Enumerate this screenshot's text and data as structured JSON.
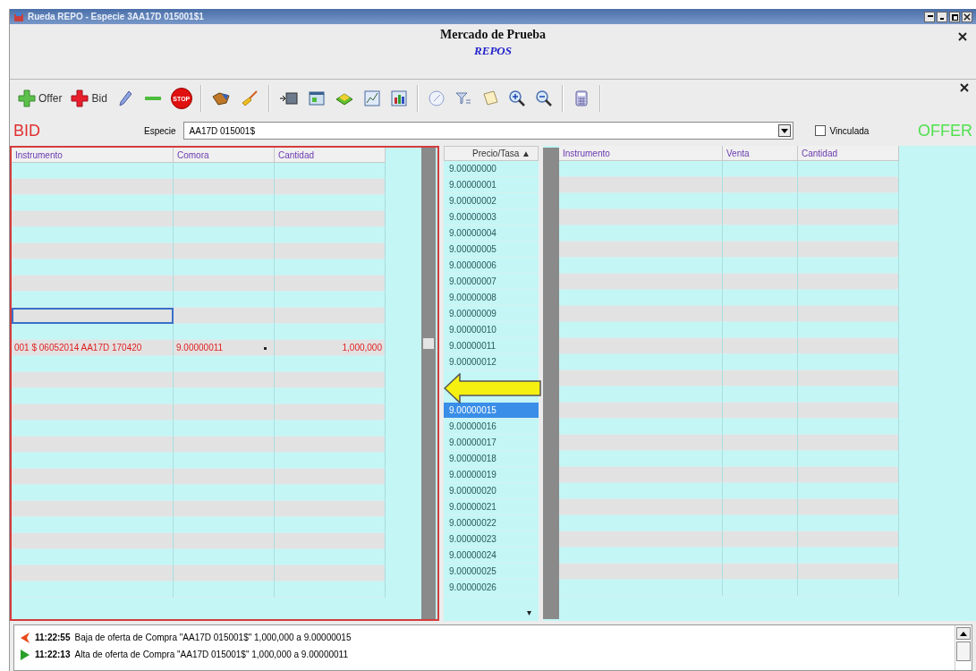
{
  "window": {
    "title": "Rueda REPO - Especie 3AA17D 015001$1"
  },
  "header": {
    "title": "Mercado de Prueba",
    "subtitle": "REPOS"
  },
  "toolbar": [
    {
      "kind": "text",
      "label": "Offer"
    },
    {
      "kind": "text",
      "label": "Bid"
    },
    {
      "kind": "icon"
    },
    {
      "kind": "icon"
    },
    {
      "kind": "stop",
      "label": "STOP"
    },
    {
      "kind": "sep"
    },
    {
      "kind": "icon"
    },
    {
      "kind": "icon"
    },
    {
      "kind": "sep"
    },
    {
      "kind": "icon"
    },
    {
      "kind": "icon"
    },
    {
      "kind": "icon"
    },
    {
      "kind": "icon"
    },
    {
      "kind": "icon"
    },
    {
      "kind": "sep"
    },
    {
      "kind": "icon"
    },
    {
      "kind": "icon"
    },
    {
      "kind": "icon"
    },
    {
      "kind": "icon"
    },
    {
      "kind": "icon"
    },
    {
      "kind": "sep"
    },
    {
      "kind": "icon"
    },
    {
      "kind": "sep"
    }
  ],
  "bid_label": "BID",
  "offer_label": "OFFER",
  "especie": {
    "label": "Especie",
    "value": "AA17D 015001$"
  },
  "vinculada": {
    "label": "Vinculada",
    "checked": false
  },
  "bid_grid": {
    "columns": [
      "Instrumento",
      "Comora",
      "Cantidad"
    ],
    "rows": [
      {
        "focused": false
      },
      {
        "focused": false
      },
      {
        "focused": false
      },
      {
        "focused": false
      },
      {
        "focused": false
      },
      {
        "focused": false
      },
      {
        "focused": false
      },
      {
        "focused": false
      },
      {
        "focused": false
      },
      {
        "focused": true
      },
      {
        "focused": false
      },
      {
        "focused": false,
        "cells": [
          "001 $ 06052014 AA17D 170420",
          "9.00000011",
          "1,000,000"
        ]
      },
      {
        "focused": false
      },
      {
        "focused": false
      },
      {
        "focused": false
      },
      {
        "focused": false
      },
      {
        "focused": false
      },
      {
        "focused": false
      },
      {
        "focused": false
      },
      {
        "focused": false
      },
      {
        "focused": false
      },
      {
        "focused": false
      },
      {
        "focused": false
      },
      {
        "focused": false
      },
      {
        "focused": false
      },
      {
        "focused": false
      },
      {
        "focused": false
      }
    ]
  },
  "price_ladder": {
    "header": "Precio/Tasa ▲",
    "sort_arrow": "▾",
    "rows": [
      {
        "kind": "price",
        "price": "9.00000000",
        "selected": false
      },
      {
        "kind": "price",
        "price": "9.00000001",
        "selected": false
      },
      {
        "kind": "price",
        "price": "9.00000002",
        "selected": false
      },
      {
        "kind": "price",
        "price": "9.00000003",
        "selected": false
      },
      {
        "kind": "price",
        "price": "9.00000004",
        "selected": false
      },
      {
        "kind": "price",
        "price": "9.00000005",
        "selected": false
      },
      {
        "kind": "price",
        "price": "9.00000006",
        "selected": false
      },
      {
        "kind": "price",
        "price": "9.00000007",
        "selected": false
      },
      {
        "kind": "price",
        "price": "9.00000008",
        "selected": false
      },
      {
        "kind": "price",
        "price": "9.00000009",
        "selected": false
      },
      {
        "kind": "price",
        "price": "9.00000010",
        "selected": false
      },
      {
        "kind": "price",
        "price": "9.00000011",
        "selected": false
      },
      {
        "kind": "price",
        "price": "9.00000012",
        "selected": false
      },
      {
        "kind": "arrow"
      },
      {
        "kind": "price",
        "price": "9.00000015",
        "selected": true
      },
      {
        "kind": "price",
        "price": "9.00000016",
        "selected": false
      },
      {
        "kind": "price",
        "price": "9.00000017",
        "selected": false
      },
      {
        "kind": "price",
        "price": "9.00000018",
        "selected": false
      },
      {
        "kind": "price",
        "price": "9.00000019",
        "selected": false
      },
      {
        "kind": "price",
        "price": "9.00000020",
        "selected": false
      },
      {
        "kind": "price",
        "price": "9.00000021",
        "selected": false
      },
      {
        "kind": "price",
        "price": "9.00000022",
        "selected": false
      },
      {
        "kind": "price",
        "price": "9.00000023",
        "selected": false
      },
      {
        "kind": "price",
        "price": "9.00000024",
        "selected": false
      },
      {
        "kind": "price",
        "price": "9.00000025",
        "selected": false
      },
      {
        "kind": "price",
        "price": "9.00000026",
        "selected": false
      }
    ]
  },
  "offer_grid": {
    "columns": [
      "Instrumento",
      "Venta",
      "Cantidad"
    ]
  },
  "log": [
    {
      "kind": "removed",
      "time": "11:22:55",
      "message": "Baja de oferta de Compra \"AA17D 015001$\" 1,000,000 a 9.00000015"
    },
    {
      "kind": "added",
      "time": "11:22:13",
      "message": "Alta de oferta de Compra \"AA17D 015001$\" 1,000,000 a 9.00000011"
    }
  ]
}
